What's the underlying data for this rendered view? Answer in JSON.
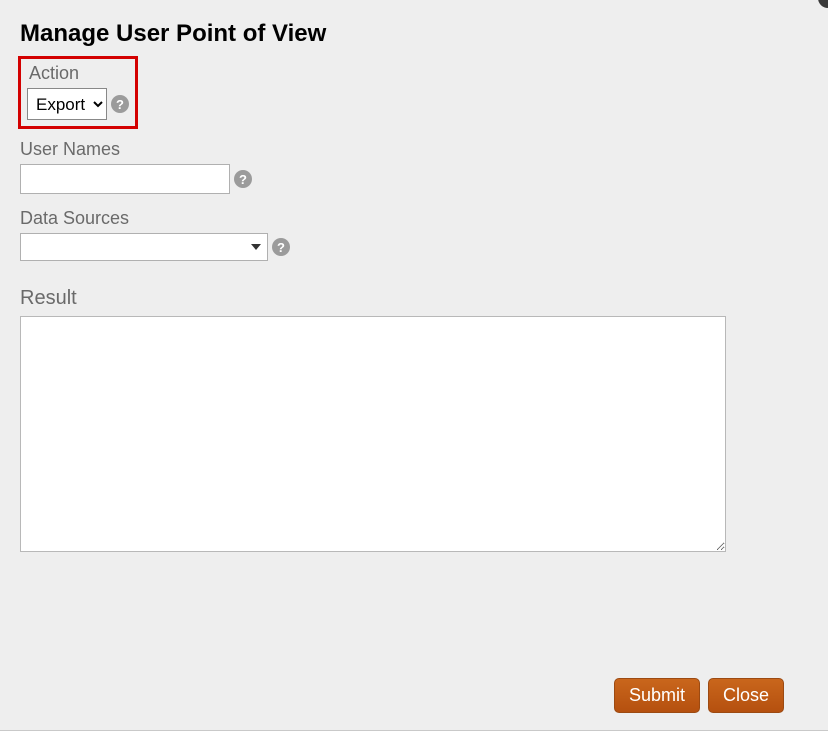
{
  "title": "Manage User Point of View",
  "fields": {
    "action": {
      "label": "Action",
      "value": "Export"
    },
    "user_names": {
      "label": "User Names",
      "value": ""
    },
    "data_sources": {
      "label": "Data Sources",
      "value": ""
    },
    "result": {
      "label": "Result",
      "value": ""
    }
  },
  "buttons": {
    "submit": "Submit",
    "close": "Close"
  },
  "help_glyph": "?"
}
